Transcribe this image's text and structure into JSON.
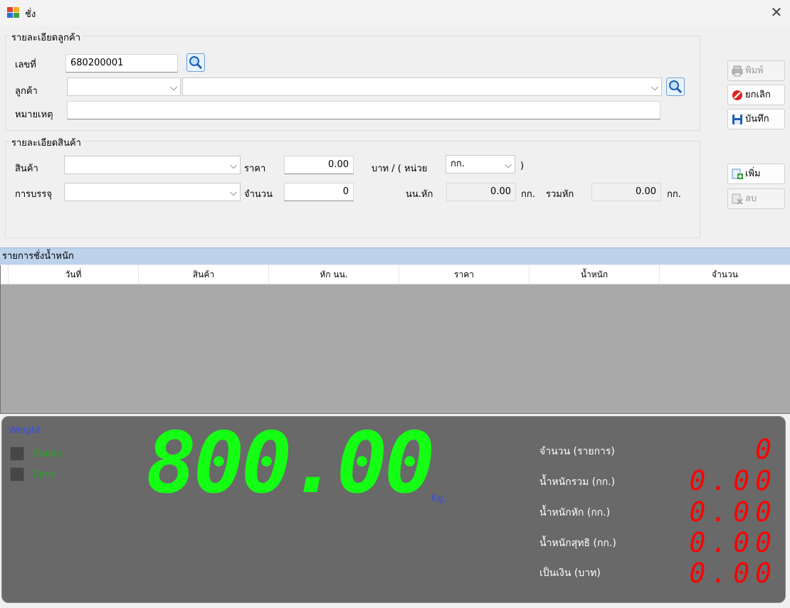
{
  "window": {
    "title": "ชั่ง",
    "close_glyph": "✕"
  },
  "customer_group": {
    "legend": "รายละเอียดลูกค้า",
    "number_label": "เลขที่",
    "number_value": "680200001",
    "customer_label": "ลูกค้า",
    "customer_code": "",
    "customer_name": "",
    "remark_label": "หมายเหตุ",
    "remark_value": ""
  },
  "product_group": {
    "legend": "รายละเอียดสินค้า",
    "product_label": "สินค้า",
    "product_value": "",
    "price_label": "ราคา",
    "price_value": "0.00",
    "unit_prefix": "บาท / ( หน่วย",
    "unit_value": "กก.",
    "unit_suffix": ")",
    "package_label": "การบรรจุ",
    "package_value": "",
    "qty_label": "จำนวน",
    "qty_value": "0",
    "deduct_label": "นน.หัก",
    "deduct_value": "0.00",
    "deduct_unit": "กก.",
    "total_deduct_label": "รวมหัก",
    "total_deduct_value": "0.00",
    "total_deduct_unit": "กก."
  },
  "buttons": {
    "print": "พิมพ์",
    "cancel": "ยกเลิก",
    "save": "บันทึก",
    "add": "เพิ่ม",
    "delete": "ลบ"
  },
  "grid": {
    "title": "รายการชั่งน้ำหนัก",
    "columns": [
      "วันที่",
      "สินค้า",
      "หัก นน.",
      "ราคา",
      "น้ำหนัก",
      "จำนวน"
    ]
  },
  "display": {
    "weight_label": "Weight",
    "stable_label": "Stable",
    "zero_label": "Zero",
    "big_weight": "800.00",
    "big_unit": "Kg.",
    "stats": [
      {
        "label": "จำนวน (รายการ)",
        "value": "0"
      },
      {
        "label": "น้ำหนักรวม (กก.)",
        "value": "0.00"
      },
      {
        "label": "น้ำหนักหัก (กก.)",
        "value": "0.00"
      },
      {
        "label": "น้ำหนักสุทธิ (กก.)",
        "value": "0.00"
      },
      {
        "label": "เป็นเงิน (บาท)",
        "value": "0.00"
      }
    ],
    "colors": {
      "big": "#14ff14",
      "stats": "#ff0000",
      "panel": "#696969",
      "label_blue": "#3a4fd6",
      "label_green": "#1fa81f"
    }
  }
}
